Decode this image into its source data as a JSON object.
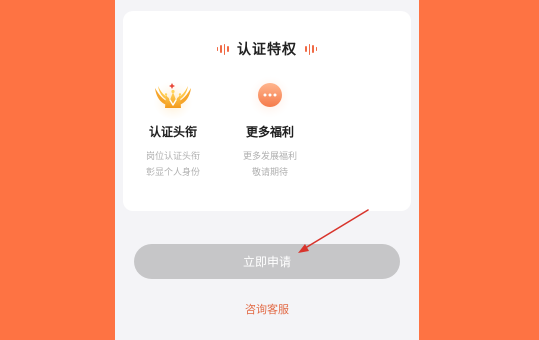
{
  "card": {
    "title": "认证特权"
  },
  "perks": [
    {
      "name": "认证头衔",
      "desc_line1": "岗位认证头衔",
      "desc_line2": "彰显个人身份",
      "icon": "crown-wings-icon"
    },
    {
      "name": "更多福利",
      "desc_line1": "更多发展福利",
      "desc_line2": "敬请期待",
      "icon": "more-dots-icon"
    }
  ],
  "actions": {
    "apply_label": "立即申请",
    "consult_label": "咨询客服"
  },
  "colors": {
    "background": "#fe7343",
    "accent": "#e26a45",
    "button_disabled": "#c6c6c8",
    "annotation_arrow": "#d8342c"
  }
}
